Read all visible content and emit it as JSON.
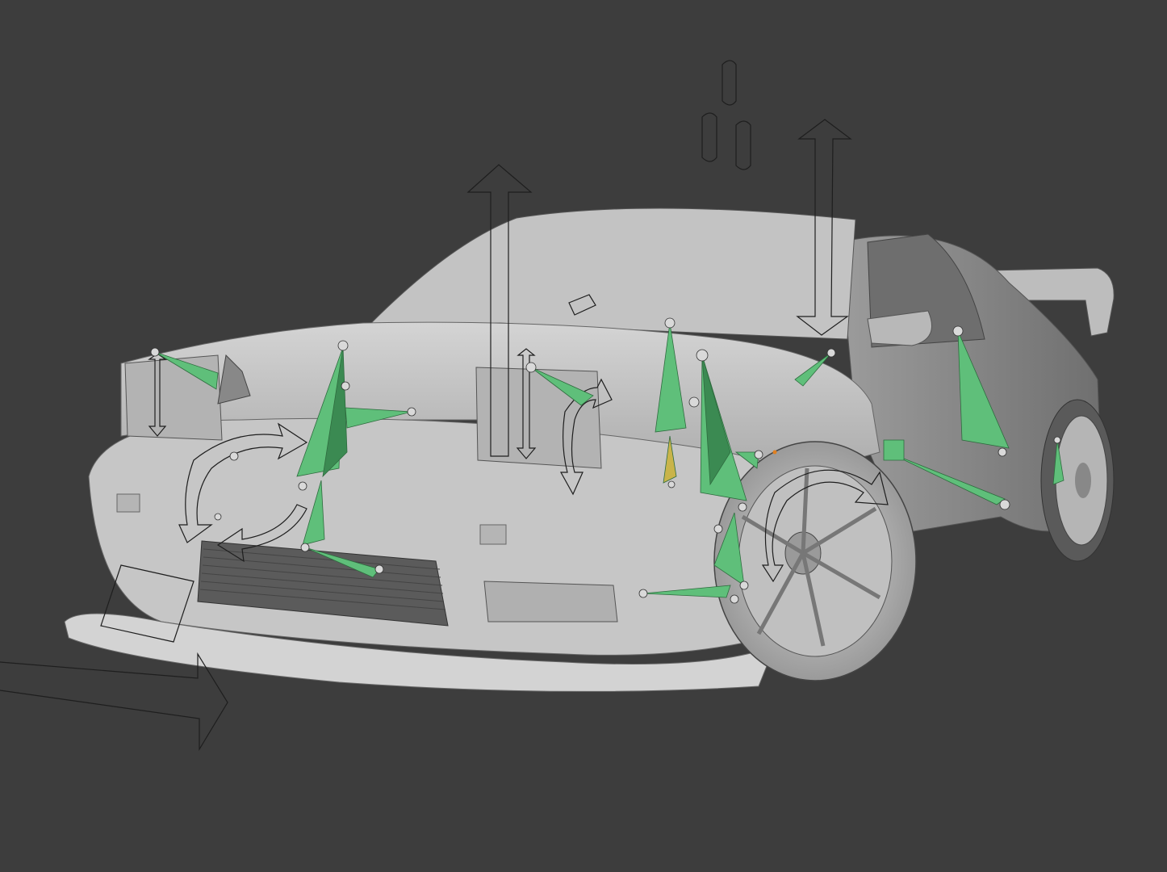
{
  "viewport": {
    "background": "#3d3d3d",
    "body_color": "#c8c8c8",
    "body_shadow": "#8d8d8d",
    "bone_color": "#5fbf7a",
    "bone_dark": "#3b8a52",
    "bone_active": "#c9b44a",
    "widget_color": "#1e1e1e",
    "joint_color": "#d9d9d9"
  },
  "scene": {
    "object": "car-body-mesh",
    "armature": "car-rig"
  }
}
